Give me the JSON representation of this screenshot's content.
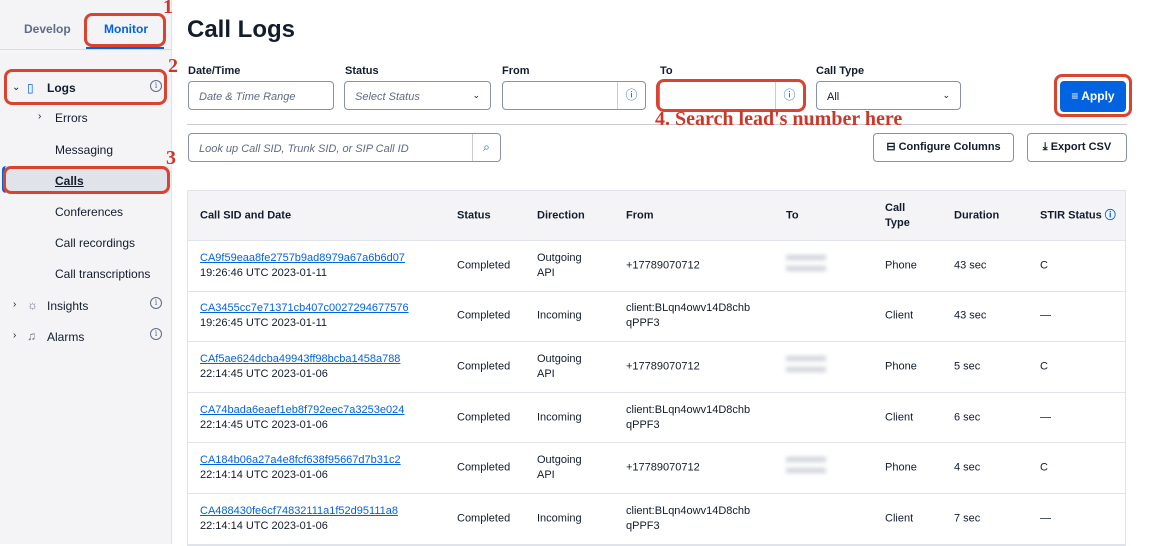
{
  "sidebar": {
    "tabs": [
      "Develop",
      "Monitor"
    ],
    "active_tab": "Monitor",
    "logs": "Logs",
    "sub_items": [
      "Errors",
      "Messaging",
      "Calls",
      "Conferences",
      "Call recordings",
      "Call transcriptions"
    ],
    "active_item": "Calls",
    "insights": "Insights",
    "alarms": "Alarms"
  },
  "header": {
    "title": "Call Logs"
  },
  "filters": {
    "date_label": "Date/Time",
    "date_placeholder": "Date & Time Range",
    "status_label": "Status",
    "status_placeholder": "Select Status",
    "from_label": "From",
    "from_value": "",
    "to_label": "To",
    "to_value": "",
    "call_type_label": "Call Type",
    "call_type_value": "All",
    "apply": "Apply"
  },
  "search": {
    "placeholder": "Look up Call SID, Trunk SID, or SIP Call ID"
  },
  "actions": {
    "configure": "Configure Columns",
    "export": "Export CSV"
  },
  "table": {
    "headers": [
      "Call SID and Date",
      "Status",
      "Direction",
      "From",
      "To",
      "Call Type",
      "Duration",
      "STIR Status"
    ],
    "rows": [
      {
        "sid": "CA9f59eaa8fe2757b9ad8979a67a6b6d07",
        "date": "19:26:46 UTC 2023-01-11",
        "status": "Completed",
        "direction": "Outgoing API",
        "from": "+17789070712",
        "type": "Phone",
        "duration": "43 sec",
        "stir": "C"
      },
      {
        "sid": "CA3455cc7e71371cb407c0027294677576",
        "date": "19:26:45 UTC 2023-01-11",
        "status": "Completed",
        "direction": "Incoming",
        "from": "client:BLqn4owv14D8chb qPPF3",
        "type": "Client",
        "duration": "43 sec",
        "stir": "—"
      },
      {
        "sid": "CAf5ae624dcba49943ff98bcba1458a788",
        "date": "22:14:45 UTC 2023-01-06",
        "status": "Completed",
        "direction": "Outgoing API",
        "from": "+17789070712",
        "type": "Phone",
        "duration": "5 sec",
        "stir": "C"
      },
      {
        "sid": "CA74bada6eaef1eb8f792eec7a3253e024",
        "date": "22:14:45 UTC 2023-01-06",
        "status": "Completed",
        "direction": "Incoming",
        "from": "client:BLqn4owv14D8chb qPPF3",
        "type": "Client",
        "duration": "6 sec",
        "stir": "—"
      },
      {
        "sid": "CA184b06a27a4e8fcf638f95667d7b31c2",
        "date": "22:14:14 UTC 2023-01-06",
        "status": "Completed",
        "direction": "Outgoing API",
        "from": "+17789070712",
        "type": "Phone",
        "duration": "4 sec",
        "stir": "C"
      },
      {
        "sid": "CA488430fe6cf74832111a1f52d95111a8",
        "date": "22:14:14 UTC 2023-01-06",
        "status": "Completed",
        "direction": "Incoming",
        "from": "client:BLqn4owv14D8chb qPPF3",
        "type": "Client",
        "duration": "7 sec",
        "stir": "—"
      }
    ]
  },
  "annotations": {
    "n1": "1",
    "n2": "2",
    "n3": "3",
    "n4": "4. Search lead's number here",
    "color": "#d9432f"
  }
}
